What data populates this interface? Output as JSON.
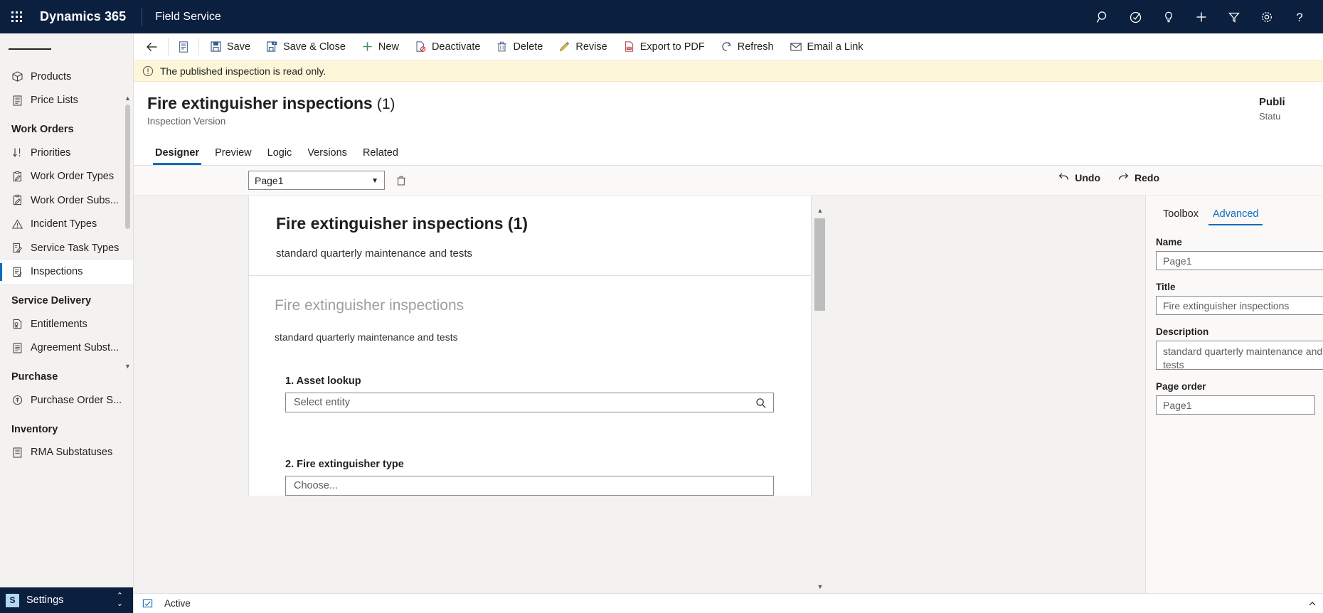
{
  "topbar": {
    "waffle_label": "app-launcher",
    "brand": "Dynamics 365",
    "app_name": "Field Service",
    "icons": [
      {
        "name": "search-icon",
        "label": "Search"
      },
      {
        "name": "focus-assist-icon",
        "label": "Focused view"
      },
      {
        "name": "lightbulb-icon",
        "label": "Insights"
      },
      {
        "name": "plus-icon",
        "label": "Quick create"
      },
      {
        "name": "filter-icon",
        "label": "Filter"
      },
      {
        "name": "gear-icon",
        "label": "Settings"
      },
      {
        "name": "help-icon",
        "label": "Help"
      }
    ]
  },
  "sidebar": {
    "groups": [
      {
        "title": "",
        "items": [
          {
            "label": "Products",
            "icon": "box-icon",
            "selected": false
          },
          {
            "label": "Price Lists",
            "icon": "document-list-icon",
            "selected": false
          }
        ]
      },
      {
        "title": "Work Orders",
        "items": [
          {
            "label": "Priorities",
            "icon": "sort-arrows-icon",
            "selected": false
          },
          {
            "label": "Work Order Types",
            "icon": "clipboard-pen-icon",
            "selected": false
          },
          {
            "label": "Work Order Subs...",
            "icon": "clipboard-pen-icon",
            "selected": false
          },
          {
            "label": "Incident Types",
            "icon": "warning-triangle-icon",
            "selected": false
          },
          {
            "label": "Service Task Types",
            "icon": "task-pen-icon",
            "selected": false
          },
          {
            "label": "Inspections",
            "icon": "checklist-icon",
            "selected": true
          }
        ]
      },
      {
        "title": "Service Delivery",
        "items": [
          {
            "label": "Entitlements",
            "icon": "certificate-icon",
            "selected": false
          },
          {
            "label": "Agreement Subst...",
            "icon": "document-list-icon",
            "selected": false
          }
        ]
      },
      {
        "title": "Purchase",
        "items": [
          {
            "label": "Purchase Order S...",
            "icon": "purchase-icon",
            "selected": false
          }
        ]
      },
      {
        "title": "Inventory",
        "items": [
          {
            "label": "RMA Substatuses",
            "icon": "document-list-icon",
            "selected": false
          }
        ]
      }
    ],
    "footer": {
      "badge": "S",
      "label": "Settings",
      "chevron": "⌃⌄"
    }
  },
  "commandbar": {
    "back_label": "Back",
    "form_selector_label": "Form selector",
    "buttons": [
      {
        "label": "Save",
        "icon": "save-icon"
      },
      {
        "label": "Save & Close",
        "icon": "save-close-icon"
      },
      {
        "label": "New",
        "icon": "plus-icon"
      },
      {
        "label": "Deactivate",
        "icon": "deactivate-icon"
      },
      {
        "label": "Delete",
        "icon": "trash-icon"
      },
      {
        "label": "Revise",
        "icon": "pencil-icon"
      },
      {
        "label": "Export to PDF",
        "icon": "pdf-icon"
      },
      {
        "label": "Refresh",
        "icon": "refresh-icon"
      },
      {
        "label": "Email a Link",
        "icon": "email-icon"
      }
    ]
  },
  "notification": {
    "icon": "info-circle-icon",
    "message": "The published inspection is read only."
  },
  "record_header": {
    "title": "Fire extinguisher inspections",
    "title_suffix": "(1)",
    "subtitle": "Inspection Version",
    "status_value": "Publi",
    "status_label": "Statu"
  },
  "tabs": [
    {
      "label": "Designer",
      "active": true
    },
    {
      "label": "Preview",
      "active": false
    },
    {
      "label": "Logic",
      "active": false
    },
    {
      "label": "Versions",
      "active": false
    },
    {
      "label": "Related",
      "active": false
    }
  ],
  "designer": {
    "page_select_value": "Page1",
    "delete_page_label": "Delete page",
    "undo_label": "Undo",
    "redo_label": "Redo",
    "card": {
      "header_title": "Fire extinguisher inspections (1)",
      "header_subtitle": "standard quarterly maintenance and tests",
      "body_title": "Fire extinguisher inspections",
      "body_subtitle": "standard quarterly maintenance and tests",
      "questions": [
        {
          "number": "1.",
          "label": "Asset lookup",
          "type": "lookup",
          "placeholder": "Select entity",
          "icon": "search-icon"
        },
        {
          "number": "2.",
          "label": "Fire extinguisher type",
          "type": "choice",
          "placeholder": "Choose...",
          "icon": ""
        }
      ]
    }
  },
  "properties_panel": {
    "tabs": [
      {
        "label": "Toolbox",
        "active": false
      },
      {
        "label": "Advanced",
        "active": true
      }
    ],
    "fields": [
      {
        "label": "Name",
        "value": "Page1",
        "kind": "input"
      },
      {
        "label": "Title",
        "value": "Fire extinguisher inspections",
        "kind": "input"
      },
      {
        "label": "Description",
        "value": "standard quarterly maintenance and tests",
        "kind": "textarea"
      },
      {
        "label": "Page order",
        "value": "Page1",
        "kind": "input-plain"
      }
    ]
  },
  "statusbar": {
    "icon": "form-state-icon",
    "text": "Active"
  },
  "colors": {
    "brand_navy": "#0b1f3f",
    "accent_blue": "#0f6cbd",
    "notif_bg": "#fdf6d8",
    "nav_bg": "#f3f2f1",
    "canvas_bg": "#f3f2f1"
  }
}
